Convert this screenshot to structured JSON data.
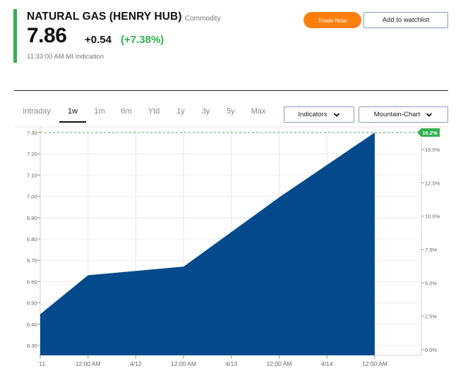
{
  "header": {
    "title": "NATURAL GAS (HENRY HUB)",
    "category": "Commodity",
    "price": "7.86",
    "change": "+0.54",
    "change_pct": "(+7.38%)",
    "timestamp": "11:33:00 AM  MI Indication",
    "accent_color": "#2fb24c"
  },
  "actions": {
    "trade_label": "Trade Now",
    "watchlist_label": "Add to watchlist"
  },
  "ranges": [
    {
      "label": "Intraday",
      "active": false
    },
    {
      "label": "1w",
      "active": true
    },
    {
      "label": "1m",
      "active": false
    },
    {
      "label": "6m",
      "active": false
    },
    {
      "label": "Ytd",
      "active": false
    },
    {
      "label": "1y",
      "active": false
    },
    {
      "label": "3y",
      "active": false
    },
    {
      "label": "5y",
      "active": false
    },
    {
      "label": "Max",
      "active": false
    }
  ],
  "controls": {
    "indicators_label": "Indicators",
    "chart_type_label": "Mountain-Chart",
    "indicators_icon": "chevron-down-icon",
    "chart_type_icon": "chevron-down-icon"
  },
  "chart_data": {
    "type": "area",
    "fill_color": "#024a8c",
    "x_ticks": [
      "'11",
      "12:00 AM",
      "4/12",
      "12:00 AM",
      "4/13",
      "12:00 AM",
      "4/14",
      "12:00 AM"
    ],
    "y_ticks_left": [
      "7.30",
      "7.20",
      "7.10",
      "7.00",
      "6.90",
      "6.80",
      "6.70",
      "6.60",
      "6.50",
      "6.40",
      "6.30"
    ],
    "y_ticks_right": [
      "15.0%",
      "12.5%",
      "10.0%",
      "7.5%",
      "5.0%",
      "2.5%",
      "0.0%"
    ],
    "current_pct_label": "16.2%",
    "ylim": [
      6.27,
      7.3
    ],
    "points": [
      {
        "x": 0,
        "y": 6.46
      },
      {
        "x": 1,
        "y": 6.64
      },
      {
        "x": 3,
        "y": 6.68
      },
      {
        "x": 5,
        "y": 7.0
      },
      {
        "x": 7,
        "y": 7.3
      }
    ],
    "grid": true
  }
}
